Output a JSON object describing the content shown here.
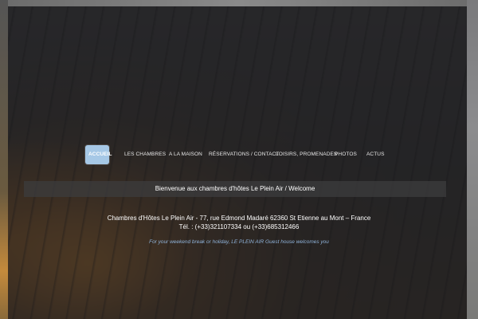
{
  "nav": {
    "items": [
      {
        "label": "ACCUEIL",
        "active": true
      },
      {
        "label": "LES CHAMBRES",
        "active": false
      },
      {
        "label": "A LA MAISON",
        "active": false
      },
      {
        "label": "RÉSERVATIONS / CONTACT",
        "active": false
      },
      {
        "label": "LOISIRS, PROMENADES",
        "active": false
      },
      {
        "label": "PHOTOS",
        "active": false
      },
      {
        "label": "ACTUS",
        "active": false
      }
    ]
  },
  "welcome": {
    "text": "Bienvenue aux chambres d'hôtes Le Plein Air / Welcome"
  },
  "address": {
    "line1": "Chambres d'Hôtes Le Plein Air - 77, rue Edmond Madaré 62360 St Etienne au Mont – France",
    "line2": "Tél. : (+33)321107334 ou (+33)685312466"
  },
  "tagline": {
    "text": "For your weekend break or holiday, LE PLEIN AIR Guest house welcomes you"
  },
  "colors": {
    "active_nav_bg": "#a6c8e6",
    "tagline": "#8fb3da",
    "panel": "#1e1e20"
  }
}
